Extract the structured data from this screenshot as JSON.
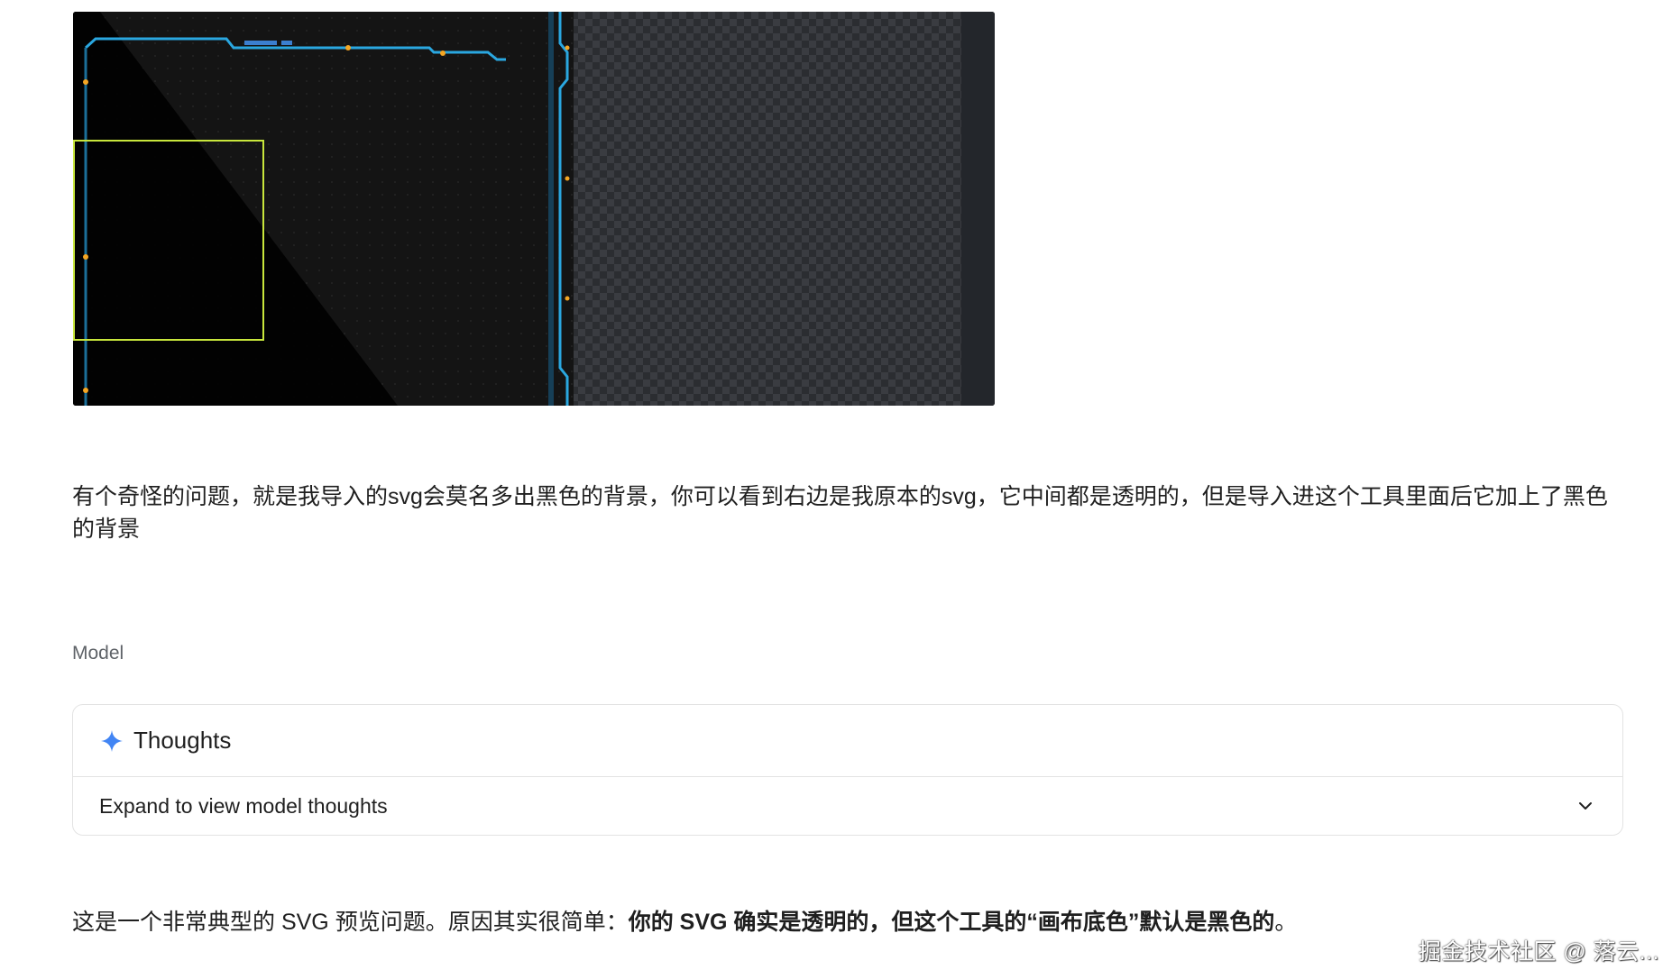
{
  "screenshot": {
    "description_icon": "svg-preview-image",
    "colors": {
      "frame_bg": "#222427",
      "canvas_black": "#0b0b0b",
      "neon_blue": "#2aa7e0",
      "accent_orange": "#f5a623",
      "selection_yellow": "#c8e63c"
    }
  },
  "user_message": {
    "text": "有个奇怪的问题，就是我导入的svg会莫名多出黑色的背景，你可以看到右边是我原本的svg，它中间都是透明的，但是导入进这个工具里面后它加上了黑色的背景"
  },
  "model_label": "Model",
  "thoughts": {
    "icon": "sparkle-icon",
    "title": "Thoughts",
    "expand_text": "Expand to view model thoughts",
    "chevron_icon": "chevron-down-icon",
    "accent_color": "#4285f4"
  },
  "answer": {
    "prefix": "这是一个非常典型的 SVG 预览问题。原因其实很简单：",
    "bold": "你的 SVG 确实是透明的，但这个工具的“画布底色”默认是黑色的",
    "suffix": "。"
  },
  "watermark": "掘金技术社区 @ 落云..."
}
